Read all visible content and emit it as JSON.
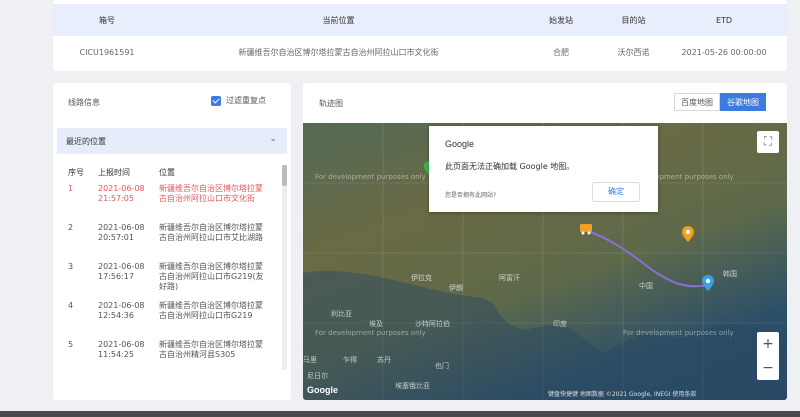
{
  "container": {
    "headers": [
      "箱号",
      "当前位置",
      "始发站",
      "目的站",
      "ETD"
    ],
    "row": {
      "box_no": "CICU1961591",
      "location": "新疆维吾尔自治区博尔塔拉蒙古自治州阿拉山口市文化街",
      "origin": "合肥",
      "destination": "沃尔西诺",
      "etd": "2021-05-26 00:00:00"
    }
  },
  "route_panel": {
    "title": "线路信息",
    "filter_label": "过滤重复点",
    "section_title": "最近的位置",
    "col_seq": "序号",
    "col_time": "上报时间",
    "col_location": "位置",
    "items": [
      {
        "seq": "1",
        "time": "2021-06-08 21:57:05",
        "location": "新疆维吾尔自治区博尔塔拉蒙古自治州阿拉山口市文化街"
      },
      {
        "seq": "2",
        "time": "2021-06-08 20:57:01",
        "location": "新疆维吾尔自治区博尔塔拉蒙古自治州阿拉山口市艾比湖路"
      },
      {
        "seq": "3",
        "time": "2021-06-08 17:56:17",
        "location": "新疆维吾尔自治区博尔塔拉蒙古自治州阿拉山口市G219(友好路)"
      },
      {
        "seq": "4",
        "time": "2021-06-08 12:54:36",
        "location": "新疆维吾尔自治区博尔塔拉蒙古自治州阿拉山口市G219"
      },
      {
        "seq": "5",
        "time": "2021-06-08 11:54:25",
        "location": "新疆维吾尔自治区博尔塔拉蒙古自治州精河县S305"
      }
    ]
  },
  "map_panel": {
    "title": "轨迹图",
    "btn_baidu": "百度地图",
    "btn_google": "谷歌地图",
    "dev_text": "For development purposes only",
    "dialog_title": "Google",
    "dialog_message": "此页面无法正确加载 Google 地图。",
    "dialog_link": "您是否拥有此网站?",
    "dialog_ok": "确定",
    "fullscreen_icon": "⛶",
    "zoom_in": "+",
    "zoom_out": "−",
    "google_logo": "Google",
    "attribution": "键盘快捷键  地图数据 ©2021  Google, INEGI  使用条款",
    "places": [
      "中国",
      "伊朗",
      "伊拉克",
      "阿富汗",
      "沙特阿拉伯",
      "印度",
      "埃及",
      "利比亚",
      "也门",
      "苏丹",
      "乍得",
      "马里",
      "尼日尔",
      "埃塞俄比亚",
      "韩国"
    ],
    "colors": {
      "route": "#8b6fd6",
      "marker_orange": "#f0a020",
      "marker_blue": "#3aa0e0",
      "marker_green": "#3cb44b"
    }
  }
}
